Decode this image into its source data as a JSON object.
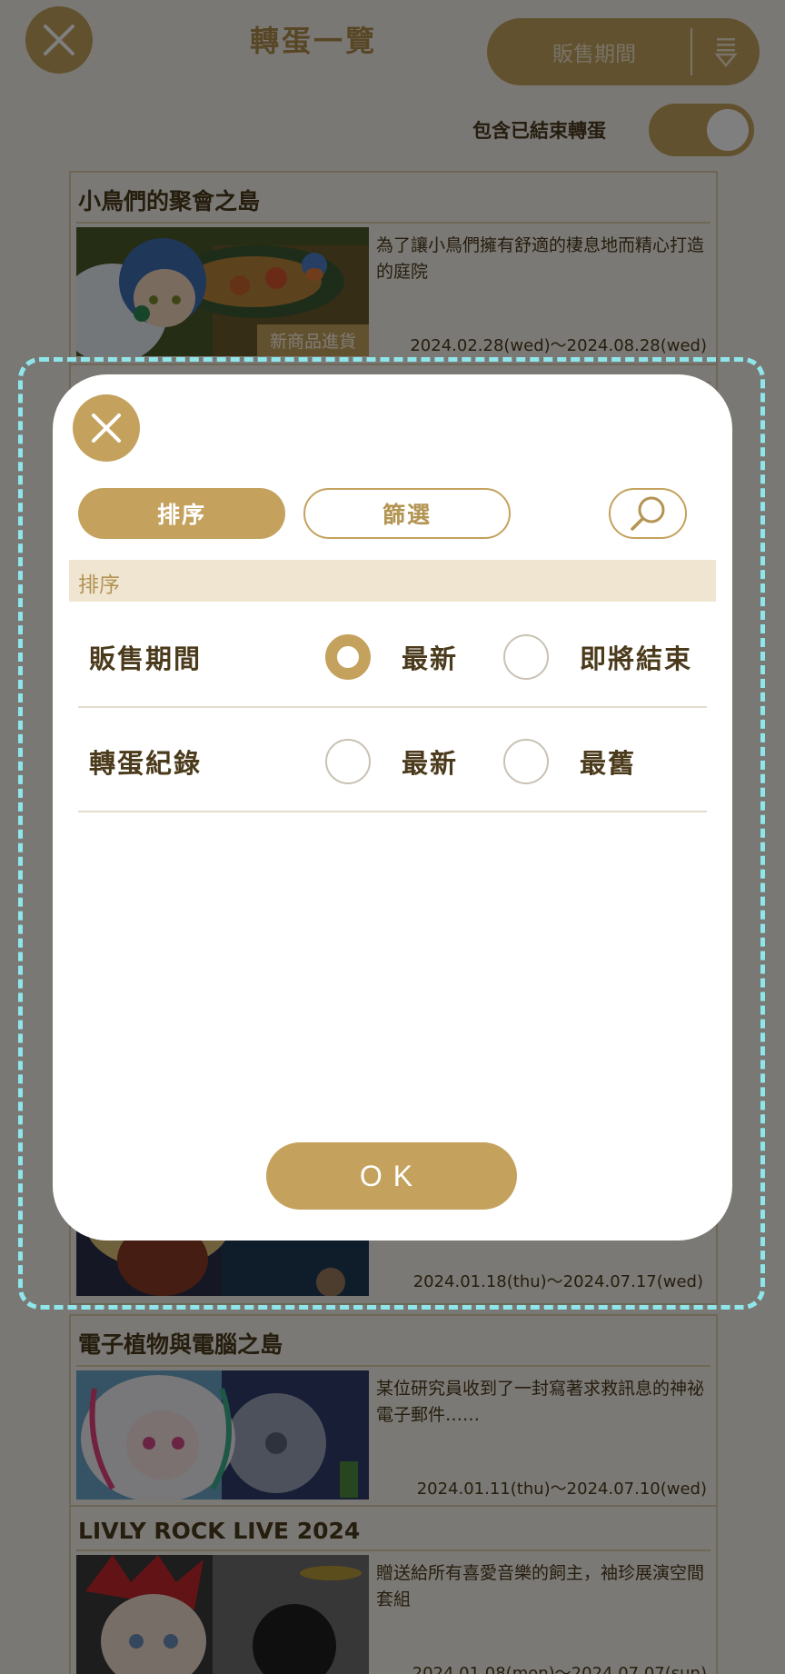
{
  "header": {
    "title": "轉蛋一覽",
    "sort_button_label": "販售期間",
    "toggle_label": "包含已結束轉蛋",
    "toggle_on": true
  },
  "cards": [
    {
      "title": "小鳥們的聚會之島",
      "description": "為了讓小鳥們擁有舒適的棲息地而精心打造的庭院",
      "dates": "2024.02.28(wed)～2024.08.28(wed)",
      "badge": "新商品進貨"
    },
    {
      "title": "",
      "description": "",
      "dates": "2024.01.18(thu)～2024.07.17(wed)",
      "badge": ""
    },
    {
      "title": "電子植物與電腦之島",
      "description": "某位研究員收到了一封寫著求救訊息的神祕電子郵件……",
      "dates": "2024.01.11(thu)～2024.07.10(wed)",
      "badge": ""
    },
    {
      "title": "LIVLY ROCK LIVE 2024",
      "description": "贈送給所有喜愛音樂的飼主，袖珍展演空間套組",
      "dates": "2024.01.08(mon)～2024.07.07(sun)",
      "badge": ""
    }
  ],
  "modal": {
    "tabs": {
      "sort": "排序",
      "filter": "篩選"
    },
    "section_title": "排序",
    "rows": [
      {
        "label": "販售期間",
        "option_a": "最新",
        "option_b": "即將結束",
        "selected": "option_a"
      },
      {
        "label": "轉蛋紀錄",
        "option_a": "最新",
        "option_b": "最舊",
        "selected": ""
      }
    ],
    "ok_label": "OK"
  },
  "colors": {
    "accent": "#c4a25e",
    "section_bg": "#efe5d1",
    "highlight": "#8fe6ea"
  }
}
